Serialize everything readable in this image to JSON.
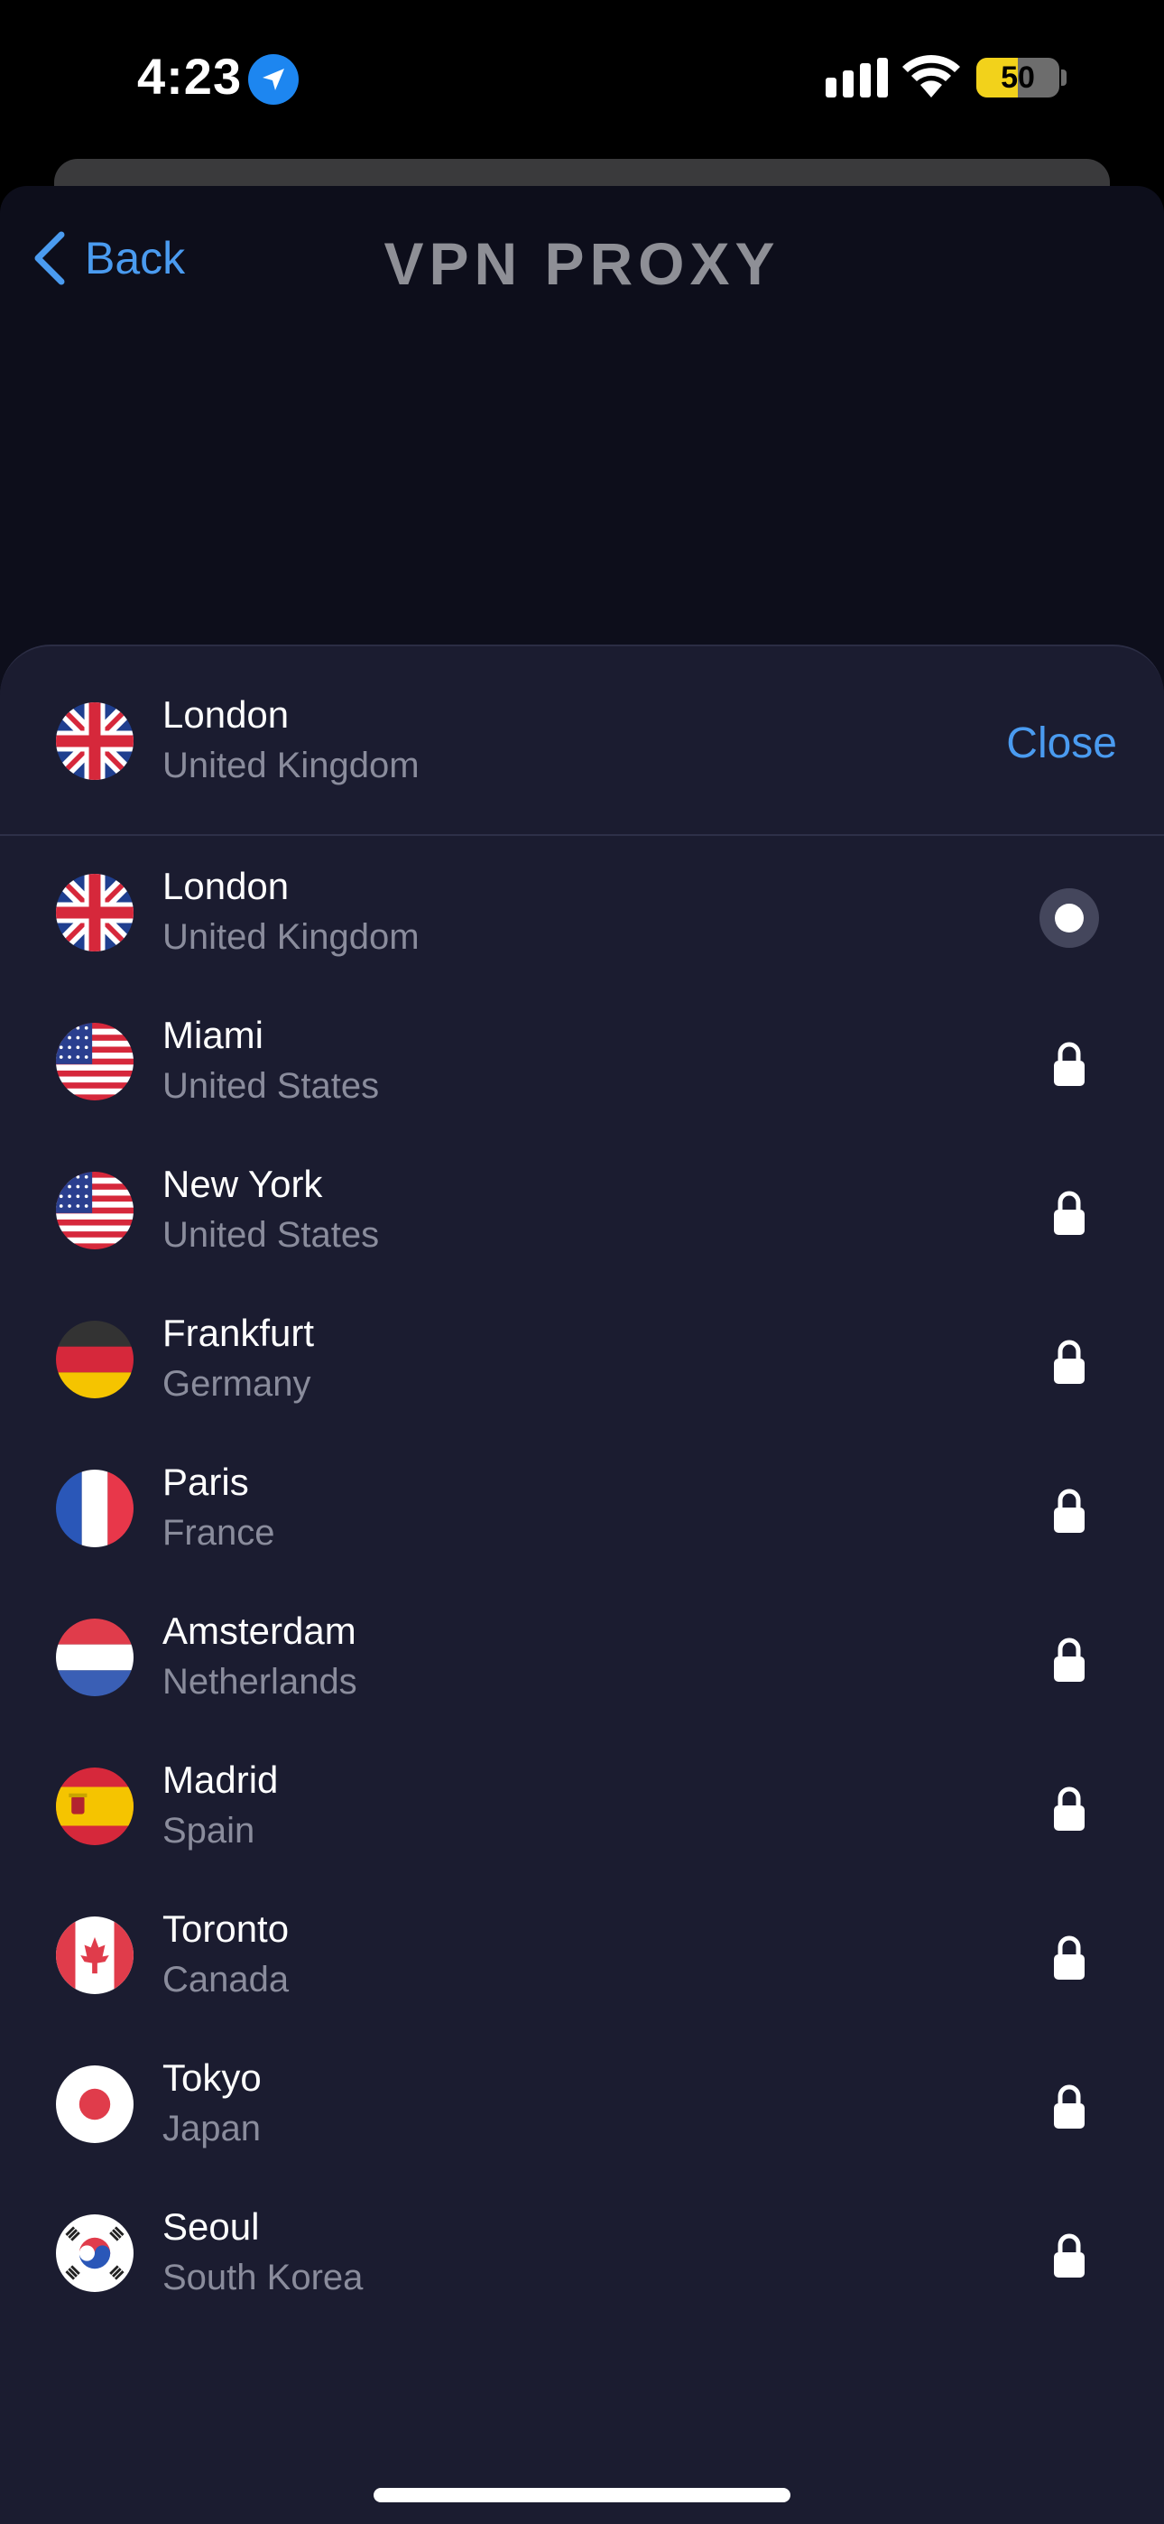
{
  "status_bar": {
    "time": "4:23",
    "battery": "50",
    "battery_level": 0.5
  },
  "nav": {
    "back_label": "Back",
    "title": "VPN PROXY"
  },
  "selected": {
    "city": "London",
    "country": "United Kingdom",
    "close_label": "Close"
  },
  "locations": [
    {
      "city": "London",
      "country": "United Kingdom",
      "flag": "uk",
      "state": "selected"
    },
    {
      "city": "Miami",
      "country": "United States",
      "flag": "us",
      "state": "locked"
    },
    {
      "city": "New York",
      "country": "United States",
      "flag": "us",
      "state": "locked"
    },
    {
      "city": "Frankfurt",
      "country": "Germany",
      "flag": "de",
      "state": "locked"
    },
    {
      "city": "Paris",
      "country": "France",
      "flag": "fr",
      "state": "locked"
    },
    {
      "city": "Amsterdam",
      "country": "Netherlands",
      "flag": "nl",
      "state": "locked"
    },
    {
      "city": "Madrid",
      "country": "Spain",
      "flag": "es",
      "state": "locked"
    },
    {
      "city": "Toronto",
      "country": "Canada",
      "flag": "ca",
      "state": "locked"
    },
    {
      "city": "Tokyo",
      "country": "Japan",
      "flag": "jp",
      "state": "locked"
    },
    {
      "city": "Seoul",
      "country": "South Korea",
      "flag": "kr",
      "state": "locked"
    }
  ],
  "colors": {
    "accent": "#4a9bf0",
    "sheet": "#1b1c30",
    "background": "#0d0e1b"
  }
}
